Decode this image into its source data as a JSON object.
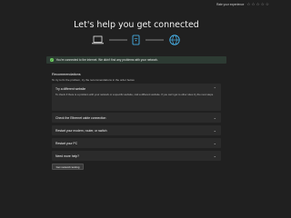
{
  "rating": {
    "label": "Rate your experience",
    "stars": [
      "☆",
      "☆",
      "☆",
      "☆",
      "☆"
    ]
  },
  "page_title": "Let's help you get connected",
  "diagram": {
    "icons": [
      "laptop-icon",
      "router-icon",
      "globe-icon"
    ],
    "accent": "#4cc2ff"
  },
  "banner": {
    "text": "You're connected to the internet. We didn't find any problems with your network.",
    "color": "#6ccb5f"
  },
  "recommendations": {
    "heading": "Recommendations",
    "subtitle": "To try to fix the problem, try the recommendations in the order below."
  },
  "cards": [
    {
      "title": "Try a different website",
      "body": "To check if there is a problem with your network or a specific website, visit a different website. If you can't get to other sites try the next steps."
    },
    {
      "title": "Check the Ethernet cable connection"
    },
    {
      "title": "Restart your modem, router, or switch"
    },
    {
      "title": "Restart your PC"
    },
    {
      "title": "Need more help?"
    }
  ],
  "button": {
    "label": "Get network testing"
  }
}
